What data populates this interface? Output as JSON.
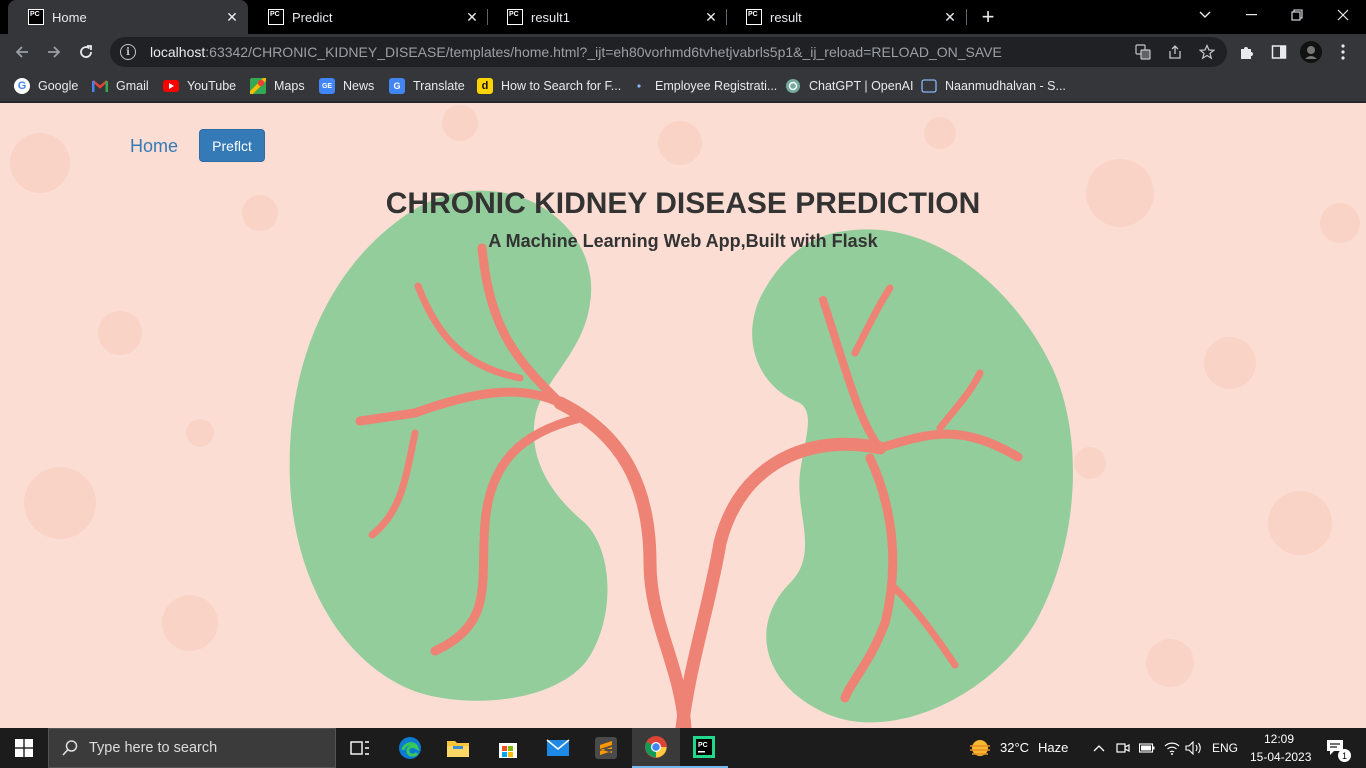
{
  "browser": {
    "tabs": [
      {
        "label": "Home",
        "favicon": "pycharm-icon",
        "active": true
      },
      {
        "label": "Predict",
        "favicon": "pycharm-icon",
        "active": false
      },
      {
        "label": "result1",
        "favicon": "pycharm-icon",
        "active": false
      },
      {
        "label": "result",
        "favicon": "pycharm-icon",
        "active": false
      }
    ],
    "url_host": "localhost",
    "url_rest": ":63342/CHRONIC_KIDNEY_DISEASE/templates/home.html?_ijt=eh80vorhmd6tvhetjvabrls5p1&_ij_reload=RELOAD_ON_SAVE",
    "bookmarks": [
      {
        "label": "Google",
        "icon": "google-icon"
      },
      {
        "label": "Gmail",
        "icon": "gmail-icon"
      },
      {
        "label": "YouTube",
        "icon": "youtube-icon"
      },
      {
        "label": "Maps",
        "icon": "maps-icon"
      },
      {
        "label": "News",
        "icon": "news-icon"
      },
      {
        "label": "Translate",
        "icon": "translate-icon"
      },
      {
        "label": "How to Search for F...",
        "icon": "d-icon"
      },
      {
        "label": "Employee Registrati...",
        "icon": "dot-icon"
      },
      {
        "label": "ChatGPT | OpenAI",
        "icon": "openai-icon"
      },
      {
        "label": "Naanmudhalvan - S...",
        "icon": "page-icon"
      }
    ]
  },
  "page": {
    "nav_home": "Home",
    "nav_predict": "Preflct",
    "title": "CHRONIC KIDNEY DISEASE PREDICTION",
    "subtitle": "A Machine Learning Web App,Built with Flask",
    "colors": {
      "background": "#fcddd3",
      "kidney": "#93cd9b",
      "vessel": "#ee8275",
      "link": "#337ab7"
    }
  },
  "taskbar": {
    "search_placeholder": "Type here to search",
    "weather_temp": "32°C",
    "weather_desc": "Haze",
    "language": "ENG",
    "time": "12:09",
    "date": "15-04-2023",
    "notification_count": "1"
  }
}
